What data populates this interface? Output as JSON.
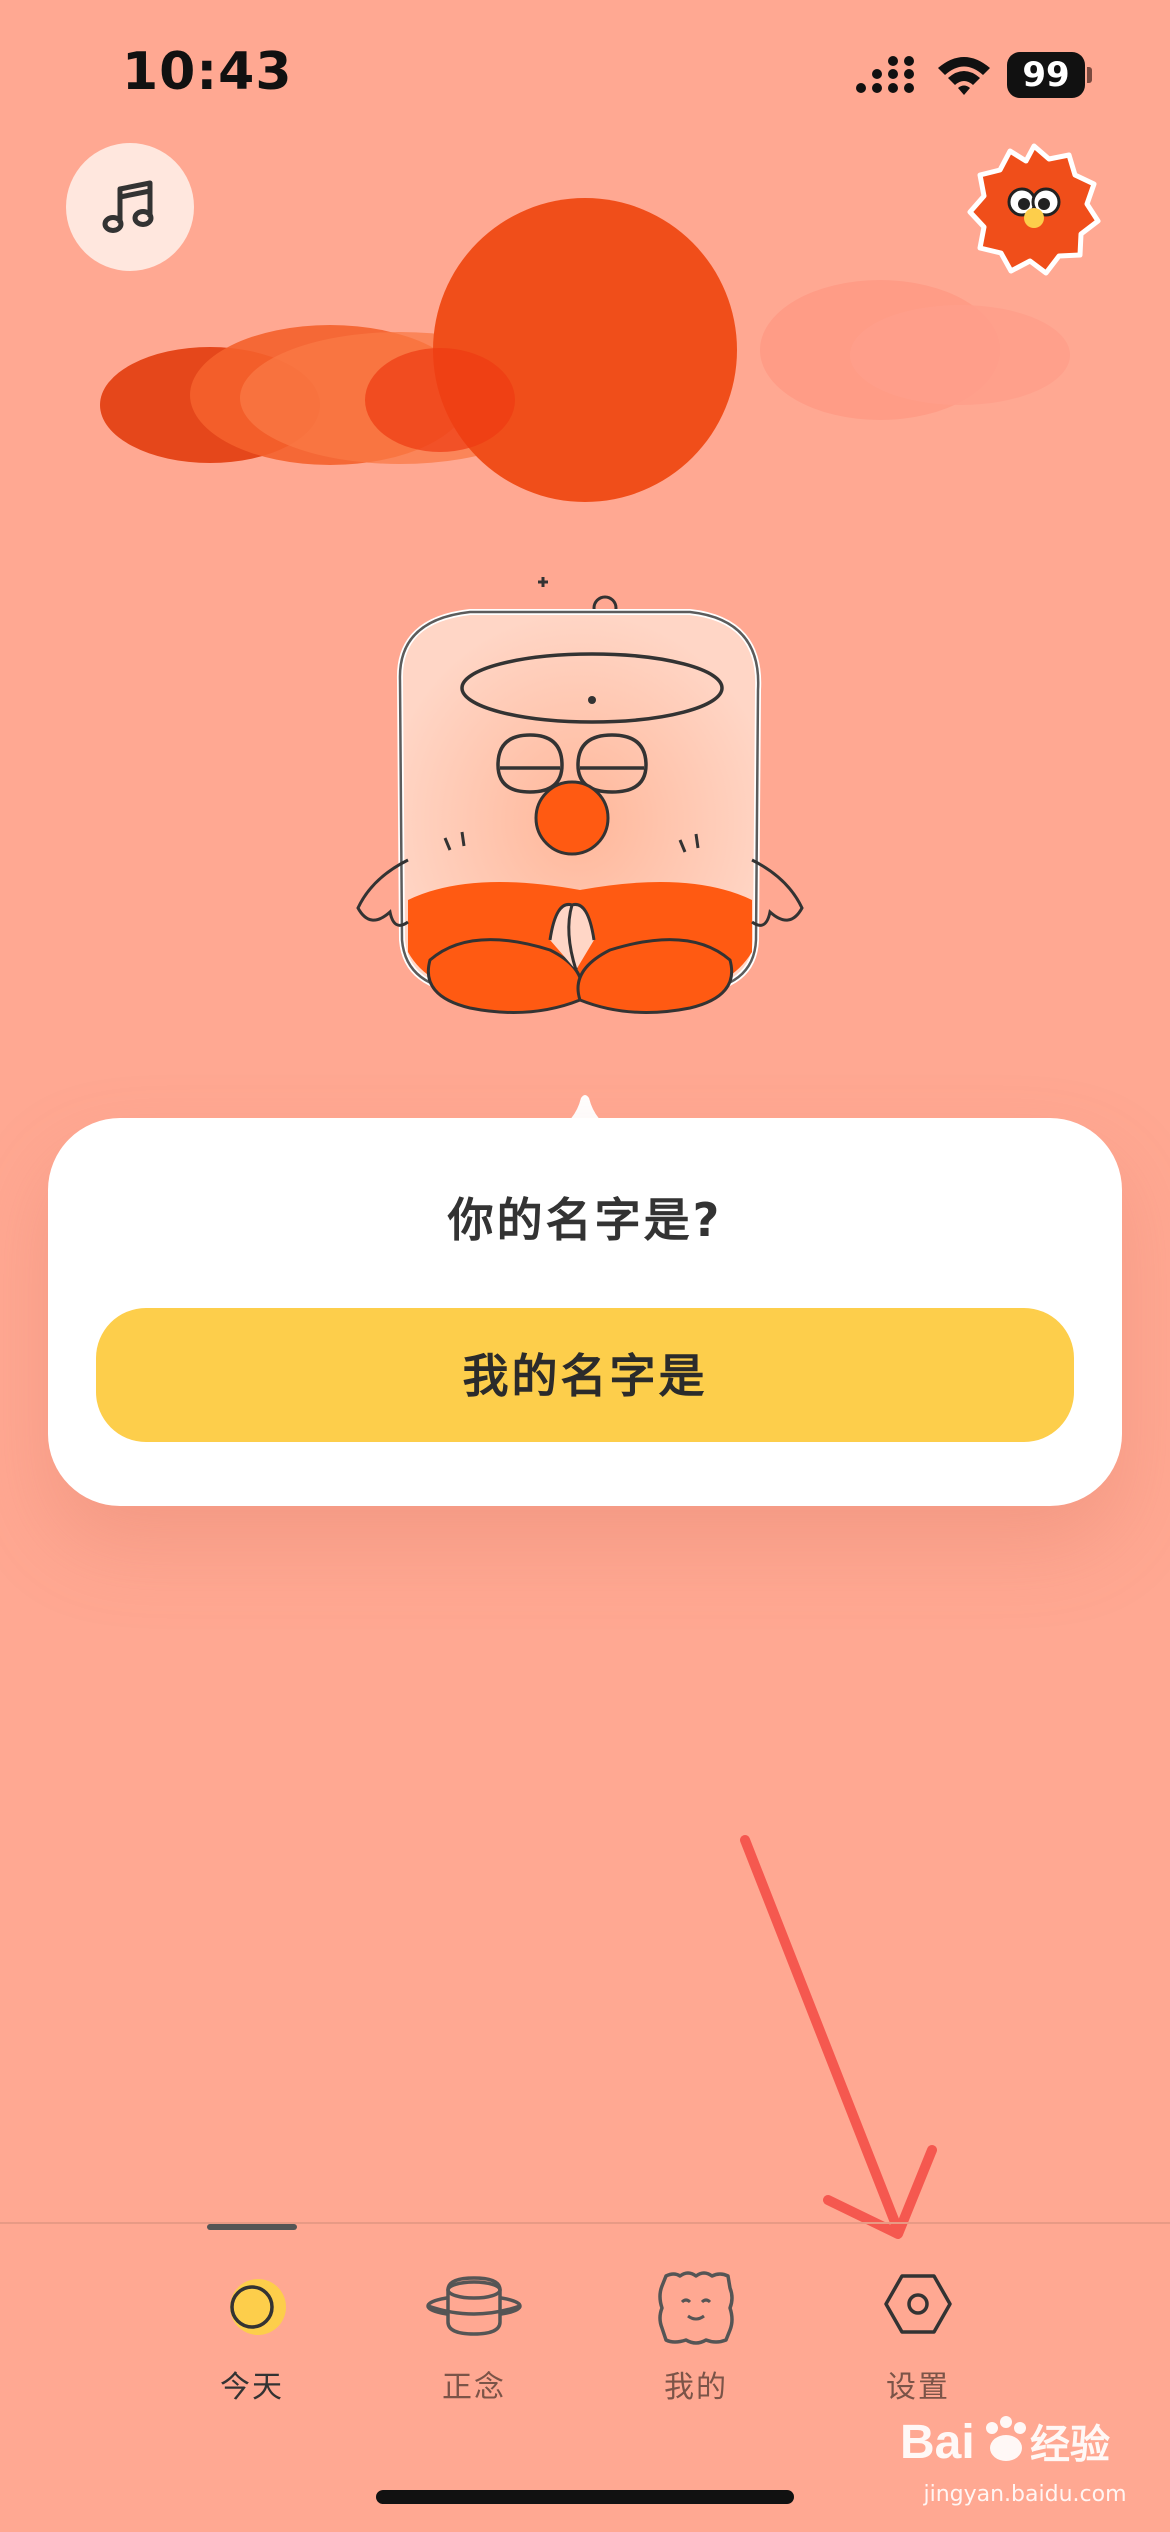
{
  "status_bar": {
    "time": "10:43",
    "battery": "99"
  },
  "top_bar": {
    "music_icon": "music-note-icon",
    "mascot_icon": "sun-mascot-icon"
  },
  "dialog": {
    "question": "你的名字是?",
    "button_label": "我的名字是"
  },
  "tab_bar": {
    "active_index": 0,
    "tabs": [
      {
        "label": "今天",
        "icon": "sun-circle-icon"
      },
      {
        "label": "正念",
        "icon": "pot-icon"
      },
      {
        "label": "我的",
        "icon": "face-cushion-icon"
      },
      {
        "label": "设置",
        "icon": "hexagon-nut-icon"
      }
    ]
  },
  "watermark": {
    "brand": "Baidu经验",
    "url": "jingyan.baidu.com"
  },
  "colors": {
    "background": "#FFA892",
    "accent_yellow": "#FDCE4B",
    "sun_orange": "#F04E1A",
    "annotation_red": "#F5584F"
  }
}
